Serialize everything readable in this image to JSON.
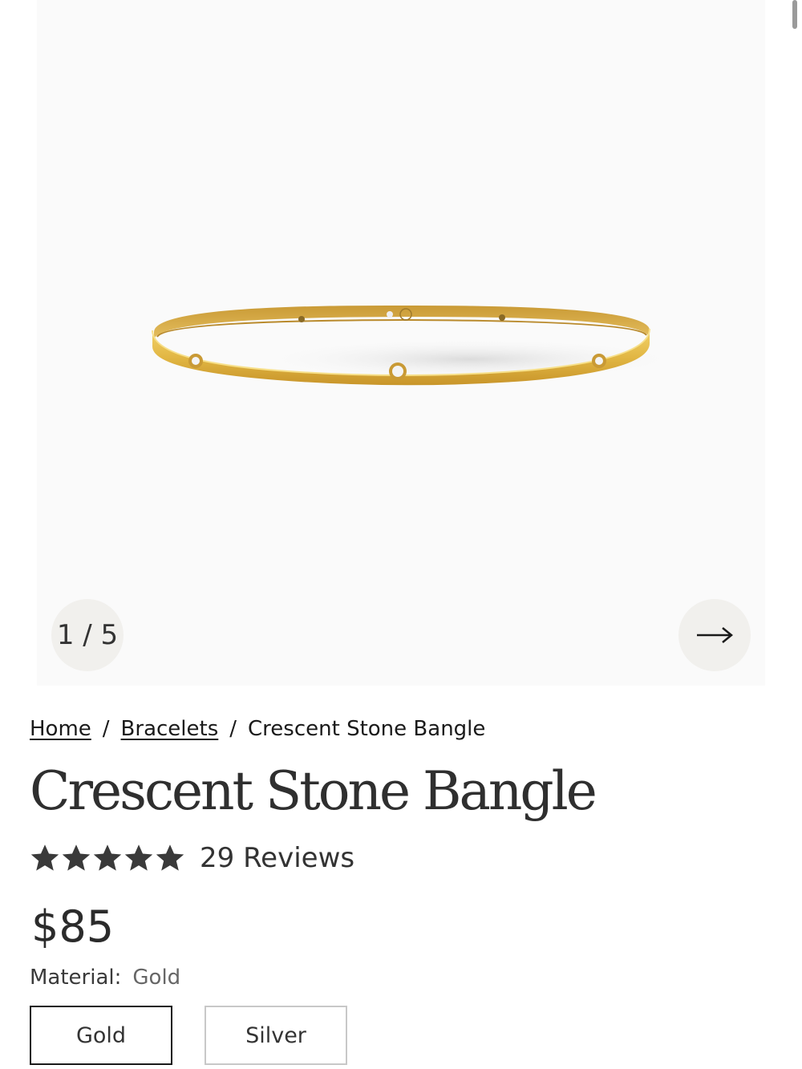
{
  "gallery": {
    "counter": "1 / 5",
    "next_icon": "arrow-right-icon",
    "image_alt": "gold bangle with white stones"
  },
  "breadcrumb": {
    "items": [
      "Home",
      "Bracelets",
      "Crescent Stone Bangle"
    ],
    "separator": "/"
  },
  "product": {
    "title": "Crescent Stone Bangle",
    "rating": 5,
    "reviews_label": "29 Reviews",
    "price": "$85",
    "material_label": "Material:",
    "material_value": "Gold",
    "options": [
      "Gold",
      "Silver"
    ],
    "selected_option": "Gold"
  },
  "colors": {
    "gold": "#d9ae3b",
    "star": "#3a3a3a",
    "circle_bg": "#f1f0ed"
  }
}
